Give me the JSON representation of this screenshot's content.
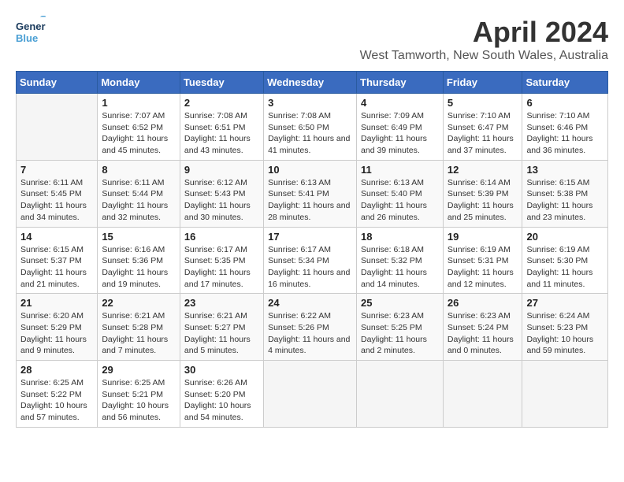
{
  "logo": {
    "line1": "General",
    "line2": "Blue",
    "icon_color": "#4a9fd4"
  },
  "title": "April 2024",
  "subtitle": "West Tamworth, New South Wales, Australia",
  "header_days": [
    "Sunday",
    "Monday",
    "Tuesday",
    "Wednesday",
    "Thursday",
    "Friday",
    "Saturday"
  ],
  "weeks": [
    [
      {
        "day": "",
        "sunrise": "",
        "sunset": "",
        "daylight": ""
      },
      {
        "day": "1",
        "sunrise": "Sunrise: 7:07 AM",
        "sunset": "Sunset: 6:52 PM",
        "daylight": "Daylight: 11 hours and 45 minutes."
      },
      {
        "day": "2",
        "sunrise": "Sunrise: 7:08 AM",
        "sunset": "Sunset: 6:51 PM",
        "daylight": "Daylight: 11 hours and 43 minutes."
      },
      {
        "day": "3",
        "sunrise": "Sunrise: 7:08 AM",
        "sunset": "Sunset: 6:50 PM",
        "daylight": "Daylight: 11 hours and 41 minutes."
      },
      {
        "day": "4",
        "sunrise": "Sunrise: 7:09 AM",
        "sunset": "Sunset: 6:49 PM",
        "daylight": "Daylight: 11 hours and 39 minutes."
      },
      {
        "day": "5",
        "sunrise": "Sunrise: 7:10 AM",
        "sunset": "Sunset: 6:47 PM",
        "daylight": "Daylight: 11 hours and 37 minutes."
      },
      {
        "day": "6",
        "sunrise": "Sunrise: 7:10 AM",
        "sunset": "Sunset: 6:46 PM",
        "daylight": "Daylight: 11 hours and 36 minutes."
      }
    ],
    [
      {
        "day": "7",
        "sunrise": "Sunrise: 6:11 AM",
        "sunset": "Sunset: 5:45 PM",
        "daylight": "Daylight: 11 hours and 34 minutes."
      },
      {
        "day": "8",
        "sunrise": "Sunrise: 6:11 AM",
        "sunset": "Sunset: 5:44 PM",
        "daylight": "Daylight: 11 hours and 32 minutes."
      },
      {
        "day": "9",
        "sunrise": "Sunrise: 6:12 AM",
        "sunset": "Sunset: 5:43 PM",
        "daylight": "Daylight: 11 hours and 30 minutes."
      },
      {
        "day": "10",
        "sunrise": "Sunrise: 6:13 AM",
        "sunset": "Sunset: 5:41 PM",
        "daylight": "Daylight: 11 hours and 28 minutes."
      },
      {
        "day": "11",
        "sunrise": "Sunrise: 6:13 AM",
        "sunset": "Sunset: 5:40 PM",
        "daylight": "Daylight: 11 hours and 26 minutes."
      },
      {
        "day": "12",
        "sunrise": "Sunrise: 6:14 AM",
        "sunset": "Sunset: 5:39 PM",
        "daylight": "Daylight: 11 hours and 25 minutes."
      },
      {
        "day": "13",
        "sunrise": "Sunrise: 6:15 AM",
        "sunset": "Sunset: 5:38 PM",
        "daylight": "Daylight: 11 hours and 23 minutes."
      }
    ],
    [
      {
        "day": "14",
        "sunrise": "Sunrise: 6:15 AM",
        "sunset": "Sunset: 5:37 PM",
        "daylight": "Daylight: 11 hours and 21 minutes."
      },
      {
        "day": "15",
        "sunrise": "Sunrise: 6:16 AM",
        "sunset": "Sunset: 5:36 PM",
        "daylight": "Daylight: 11 hours and 19 minutes."
      },
      {
        "day": "16",
        "sunrise": "Sunrise: 6:17 AM",
        "sunset": "Sunset: 5:35 PM",
        "daylight": "Daylight: 11 hours and 17 minutes."
      },
      {
        "day": "17",
        "sunrise": "Sunrise: 6:17 AM",
        "sunset": "Sunset: 5:34 PM",
        "daylight": "Daylight: 11 hours and 16 minutes."
      },
      {
        "day": "18",
        "sunrise": "Sunrise: 6:18 AM",
        "sunset": "Sunset: 5:32 PM",
        "daylight": "Daylight: 11 hours and 14 minutes."
      },
      {
        "day": "19",
        "sunrise": "Sunrise: 6:19 AM",
        "sunset": "Sunset: 5:31 PM",
        "daylight": "Daylight: 11 hours and 12 minutes."
      },
      {
        "day": "20",
        "sunrise": "Sunrise: 6:19 AM",
        "sunset": "Sunset: 5:30 PM",
        "daylight": "Daylight: 11 hours and 11 minutes."
      }
    ],
    [
      {
        "day": "21",
        "sunrise": "Sunrise: 6:20 AM",
        "sunset": "Sunset: 5:29 PM",
        "daylight": "Daylight: 11 hours and 9 minutes."
      },
      {
        "day": "22",
        "sunrise": "Sunrise: 6:21 AM",
        "sunset": "Sunset: 5:28 PM",
        "daylight": "Daylight: 11 hours and 7 minutes."
      },
      {
        "day": "23",
        "sunrise": "Sunrise: 6:21 AM",
        "sunset": "Sunset: 5:27 PM",
        "daylight": "Daylight: 11 hours and 5 minutes."
      },
      {
        "day": "24",
        "sunrise": "Sunrise: 6:22 AM",
        "sunset": "Sunset: 5:26 PM",
        "daylight": "Daylight: 11 hours and 4 minutes."
      },
      {
        "day": "25",
        "sunrise": "Sunrise: 6:23 AM",
        "sunset": "Sunset: 5:25 PM",
        "daylight": "Daylight: 11 hours and 2 minutes."
      },
      {
        "day": "26",
        "sunrise": "Sunrise: 6:23 AM",
        "sunset": "Sunset: 5:24 PM",
        "daylight": "Daylight: 11 hours and 0 minutes."
      },
      {
        "day": "27",
        "sunrise": "Sunrise: 6:24 AM",
        "sunset": "Sunset: 5:23 PM",
        "daylight": "Daylight: 10 hours and 59 minutes."
      }
    ],
    [
      {
        "day": "28",
        "sunrise": "Sunrise: 6:25 AM",
        "sunset": "Sunset: 5:22 PM",
        "daylight": "Daylight: 10 hours and 57 minutes."
      },
      {
        "day": "29",
        "sunrise": "Sunrise: 6:25 AM",
        "sunset": "Sunset: 5:21 PM",
        "daylight": "Daylight: 10 hours and 56 minutes."
      },
      {
        "day": "30",
        "sunrise": "Sunrise: 6:26 AM",
        "sunset": "Sunset: 5:20 PM",
        "daylight": "Daylight: 10 hours and 54 minutes."
      },
      {
        "day": "",
        "sunrise": "",
        "sunset": "",
        "daylight": ""
      },
      {
        "day": "",
        "sunrise": "",
        "sunset": "",
        "daylight": ""
      },
      {
        "day": "",
        "sunrise": "",
        "sunset": "",
        "daylight": ""
      },
      {
        "day": "",
        "sunrise": "",
        "sunset": "",
        "daylight": ""
      }
    ]
  ]
}
